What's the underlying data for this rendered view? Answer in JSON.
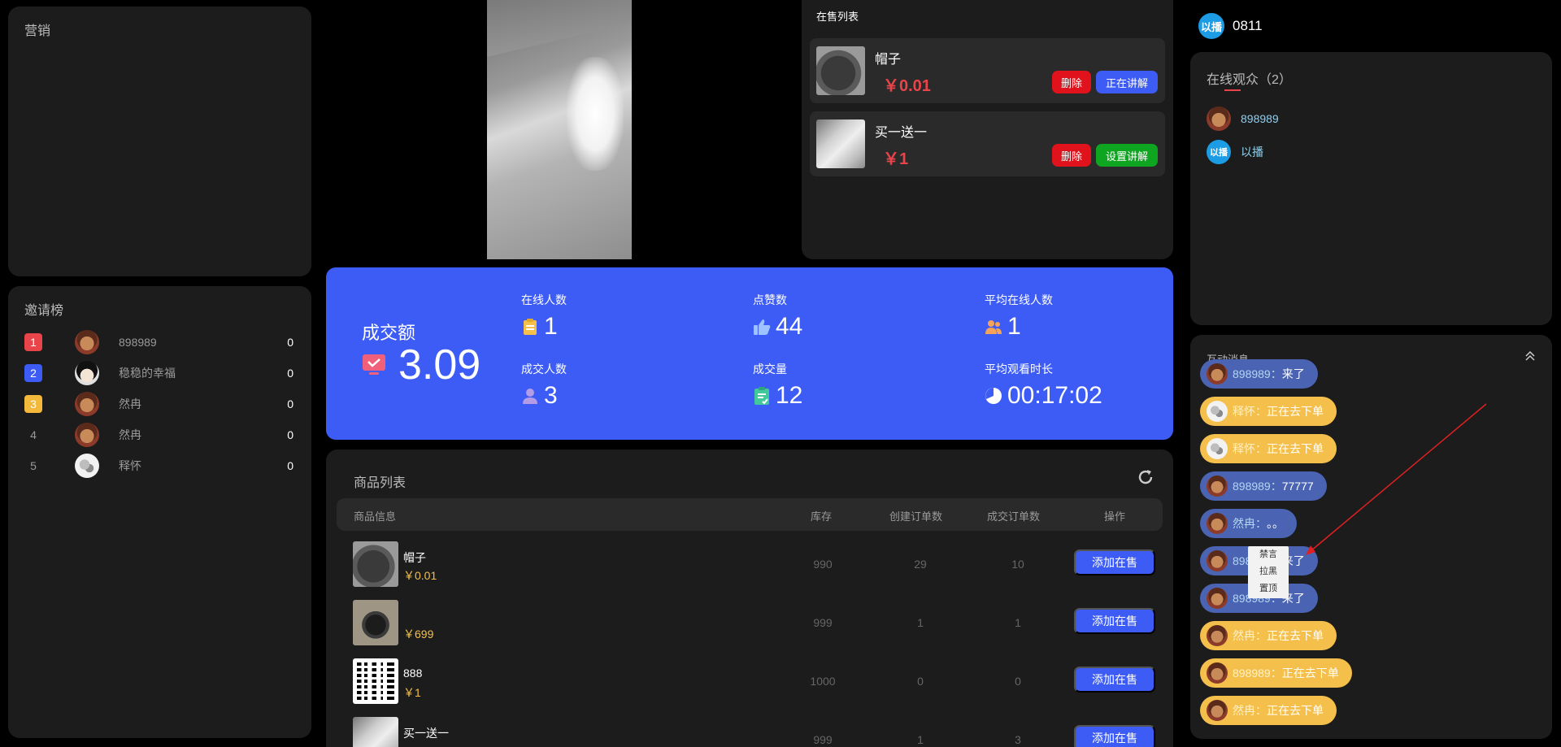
{
  "marketing": {
    "title": "营销"
  },
  "invite": {
    "title": "邀请榜",
    "rows": [
      {
        "rank": "1",
        "name": "898989",
        "count": "0",
        "color": "#e8444a"
      },
      {
        "rank": "2",
        "name": "稳稳的幸福",
        "count": "0",
        "color": "#3d5cf5"
      },
      {
        "rank": "3",
        "name": "然冉",
        "count": "0",
        "color": "#f4b93a"
      },
      {
        "rank": "4",
        "name": "然冉",
        "count": "0"
      },
      {
        "rank": "5",
        "name": "释怀",
        "count": "0"
      }
    ]
  },
  "onsale": {
    "title": "在售列表",
    "items": [
      {
        "name": "帽子",
        "price": "￥0.01",
        "delete_label": "删除",
        "action_label": "正在讲解"
      },
      {
        "name": "买一送一",
        "price": "￥1",
        "delete_label": "删除",
        "action_label": "设置讲解"
      }
    ]
  },
  "stats": {
    "gmv_label": "成交额",
    "gmv_value": "3.09",
    "items": [
      {
        "label": "在线人数",
        "value": "1",
        "icon": "clipboard-icon"
      },
      {
        "label": "点赞数",
        "value": "44",
        "icon": "thumbs-up-icon"
      },
      {
        "label": "平均在线人数",
        "value": "1",
        "icon": "users-icon"
      },
      {
        "label": "成交人数",
        "value": "3",
        "icon": "user-icon"
      },
      {
        "label": "成交量",
        "value": "12",
        "icon": "checklist-icon"
      },
      {
        "label": "平均观看时长",
        "value": "00:17:02",
        "icon": "pie-icon"
      }
    ]
  },
  "products": {
    "title": "商品列表",
    "columns": [
      "商品信息",
      "库存",
      "创建订单数",
      "成交订单数",
      "操作"
    ],
    "add_label": "添加在售",
    "rows": [
      {
        "name": "帽子",
        "price": "￥0.01",
        "stock": "990",
        "created": "29",
        "closed": "10",
        "thumb": "hat"
      },
      {
        "name": "",
        "price": "￥699",
        "stock": "999",
        "created": "1",
        "closed": "1",
        "thumb": "box"
      },
      {
        "name": "888",
        "price": "￥1",
        "stock": "1000",
        "created": "0",
        "closed": "0",
        "thumb": "qr"
      },
      {
        "name": "买一送一",
        "price": "",
        "stock": "999",
        "created": "1",
        "closed": "3",
        "thumb": "fabric"
      }
    ]
  },
  "room": {
    "badge": "以播",
    "name": "0811"
  },
  "audience": {
    "title": "在线观众（2）",
    "viewers": [
      {
        "name": "898989"
      },
      {
        "name": "以播",
        "badge": "以播"
      }
    ]
  },
  "messages": {
    "title": "互动消息",
    "items": [
      {
        "name": "898989：",
        "text": "来了",
        "style": "blue"
      },
      {
        "name": "释怀：",
        "text": "正在去下单",
        "style": "yellow"
      },
      {
        "name": "释怀：",
        "text": "正在去下单",
        "style": "yellow"
      },
      {
        "name": "898989：",
        "text": "77777",
        "style": "blue"
      },
      {
        "name": "然冉：",
        "text": "。。",
        "style": "blue"
      },
      {
        "name": "898989：",
        "text": "来了",
        "style": "blue"
      },
      {
        "name": "898989：",
        "text": "来了",
        "style": "blue"
      },
      {
        "name": "然冉：",
        "text": "正在去下单",
        "style": "yellow"
      },
      {
        "name": "898989：",
        "text": "正在去下单",
        "style": "yellow"
      },
      {
        "name": "然冉：",
        "text": "正在去下单",
        "style": "yellow"
      }
    ],
    "context_menu": [
      "禁言",
      "拉黑",
      "置顶"
    ]
  }
}
